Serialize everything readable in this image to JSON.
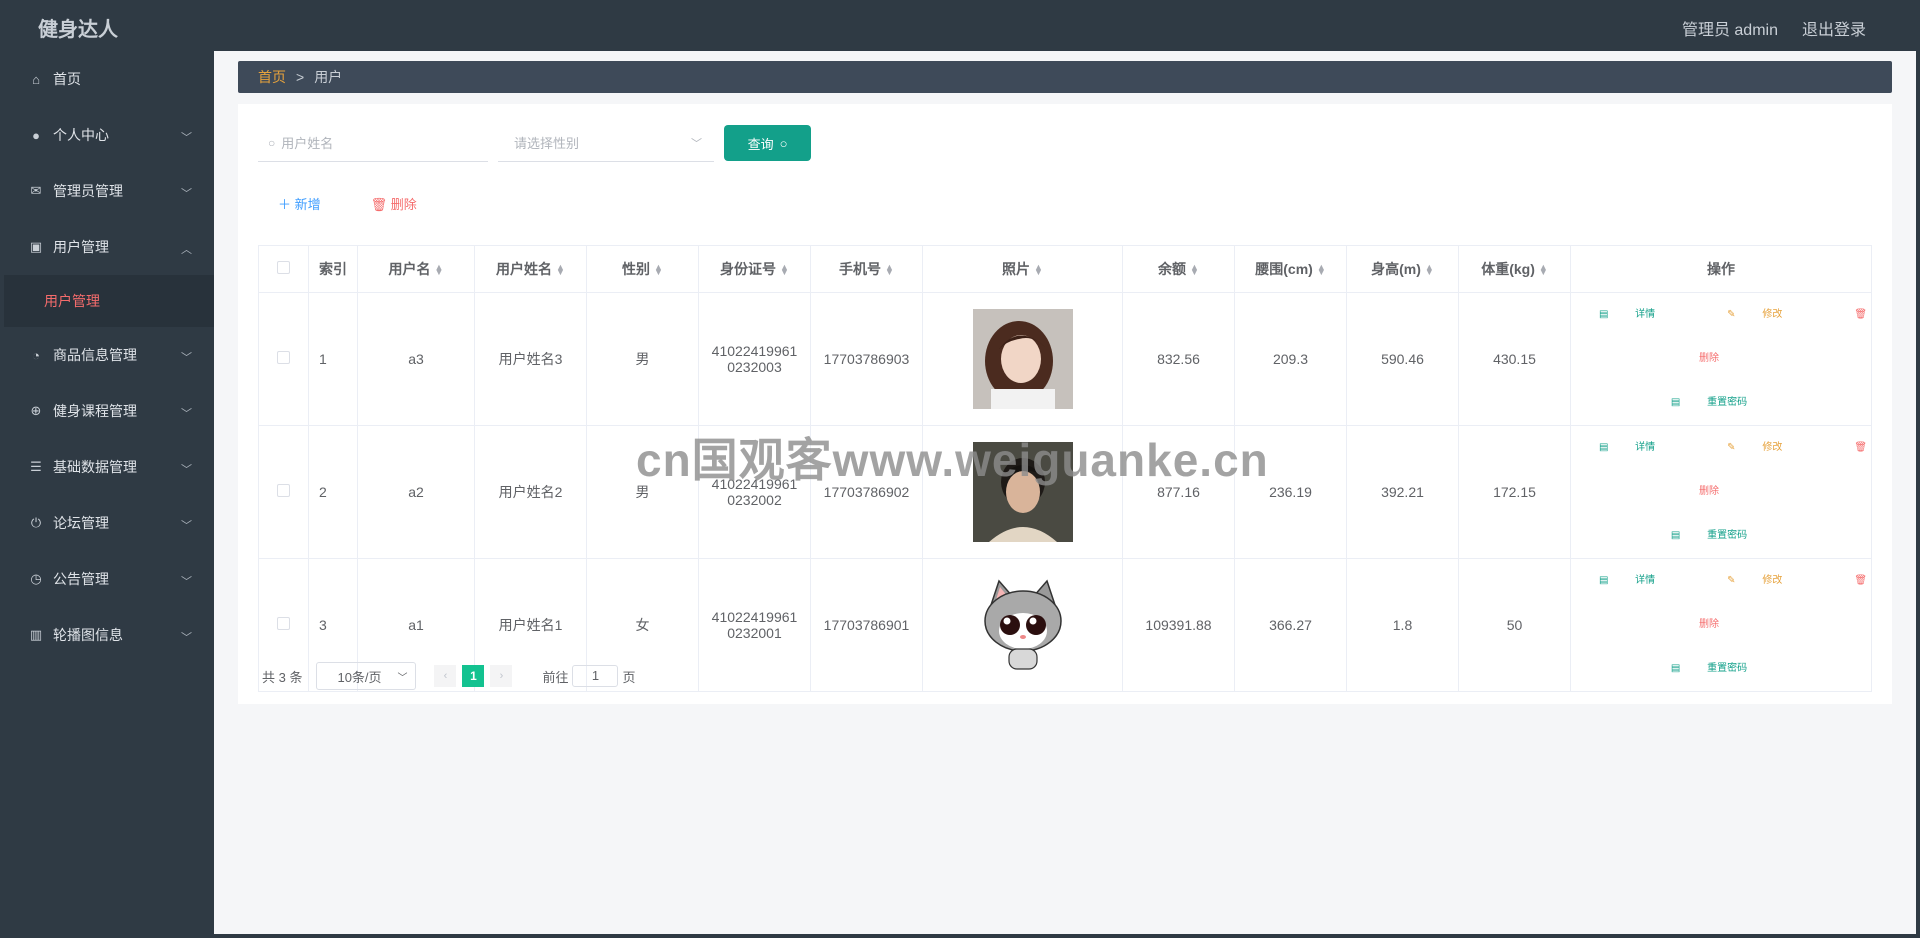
{
  "header": {
    "brand": "健身达人",
    "user": "管理员 admin",
    "logout": "退出登录"
  },
  "sidebar": {
    "items": [
      {
        "label": "首页",
        "icon": "home-icon"
      },
      {
        "label": "个人中心",
        "icon": "user-icon"
      },
      {
        "label": "管理员管理",
        "icon": "mail-icon"
      },
      {
        "label": "用户管理",
        "icon": "clipboard-icon"
      },
      {
        "label": "商品信息管理",
        "icon": "dashboard-icon"
      },
      {
        "label": "健身课程管理",
        "icon": "target-icon"
      },
      {
        "label": "基础数据管理",
        "icon": "list-icon"
      },
      {
        "label": "论坛管理",
        "icon": "power-icon"
      },
      {
        "label": "公告管理",
        "icon": "clock-icon"
      },
      {
        "label": "轮播图信息",
        "icon": "book-icon"
      }
    ],
    "submenu_active": "用户管理"
  },
  "breadcrumb": {
    "home": "首页",
    "sep": ">",
    "current": "用户"
  },
  "search": {
    "name_placeholder": "用户姓名",
    "gender_placeholder": "请选择性别",
    "query_label": "查询"
  },
  "actions": {
    "add_label": "新增",
    "delete_label": "删除"
  },
  "table": {
    "headers": [
      "索引",
      "用户名",
      "用户姓名",
      "性别",
      "身份证号",
      "手机号",
      "照片",
      "余额",
      "腰围(cm)",
      "身高(m)",
      "体重(kg)",
      "操作"
    ],
    "rows": [
      {
        "index": "1",
        "username": "a3",
        "realname": "用户姓名3",
        "gender": "男",
        "id_line1": "41022419961",
        "id_line2": "0232003",
        "phone": "17703786903",
        "balance": "832.56",
        "waist": "209.3",
        "height": "590.46",
        "weight": "430.15"
      },
      {
        "index": "2",
        "username": "a2",
        "realname": "用户姓名2",
        "gender": "男",
        "id_line1": "41022419961",
        "id_line2": "0232002",
        "phone": "17703786902",
        "balance": "877.16",
        "waist": "236.19",
        "height": "392.21",
        "weight": "172.15"
      },
      {
        "index": "3",
        "username": "a1",
        "realname": "用户姓名1",
        "gender": "女",
        "id_line1": "41022419961",
        "id_line2": "0232001",
        "phone": "17703786901",
        "balance": "109391.88",
        "waist": "366.27",
        "height": "1.8",
        "weight": "50"
      }
    ],
    "ops": {
      "detail": "详情",
      "edit": "修改",
      "delete": "删除",
      "reset": "重置密码"
    }
  },
  "pagination": {
    "total": "共 3 条",
    "page_size": "10条/页",
    "current": "1",
    "goto_prefix": "前往",
    "goto_value": "1",
    "goto_suffix": "页"
  },
  "watermark": "cn国观客www.weiguanke.cn"
}
